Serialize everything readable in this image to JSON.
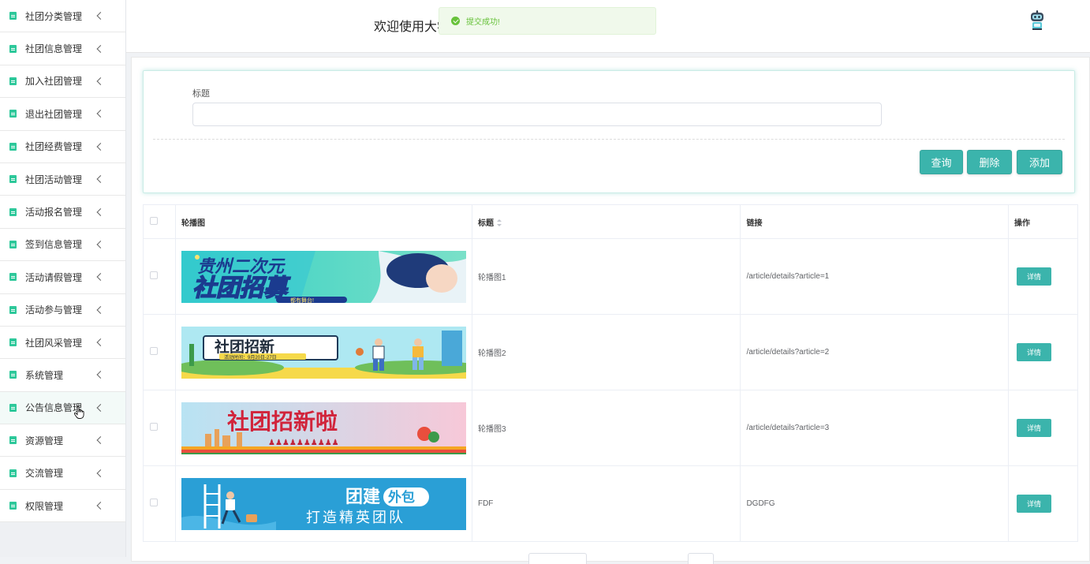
{
  "sidebar": {
    "items": [
      {
        "label": "社团分类管理"
      },
      {
        "label": "社团信息管理"
      },
      {
        "label": "加入社团管理"
      },
      {
        "label": "退出社团管理"
      },
      {
        "label": "社团经费管理"
      },
      {
        "label": "社团活动管理"
      },
      {
        "label": "活动报名管理"
      },
      {
        "label": "签到信息管理"
      },
      {
        "label": "活动请假管理"
      },
      {
        "label": "活动参与管理"
      },
      {
        "label": "社团风采管理"
      },
      {
        "label": "系统管理"
      },
      {
        "label": "公告信息管理"
      },
      {
        "label": "资源管理"
      },
      {
        "label": "交流管理"
      },
      {
        "label": "权限管理"
      }
    ],
    "active_index": 12,
    "accent_color": "#2dc89a"
  },
  "header": {
    "welcome": "欢迎使用大学",
    "avatar_icon": "robot-icon"
  },
  "toast": {
    "message": "提交成功!",
    "type": "success",
    "color": "#67c23a"
  },
  "search": {
    "title_label": "标题",
    "title_value": "",
    "query_label": "查询",
    "delete_label": "删除",
    "add_label": "添加",
    "button_color": "#3bb4ac"
  },
  "table": {
    "headers": {
      "image": "轮播图",
      "title": "标题",
      "link": "链接",
      "operation": "操作"
    },
    "rows": [
      {
        "title": "轮播图1",
        "link": "/article/details?article=1",
        "detail": "详情",
        "banner": {
          "line1": "贵州二次元",
          "line2": "社团招募",
          "line3": "都有舞台!"
        }
      },
      {
        "title": "轮播图2",
        "link": "/article/details?article=2",
        "detail": "详情",
        "banner": {
          "line1": "社团招新",
          "line2": "活动时间：9月20日-27日"
        }
      },
      {
        "title": "轮播图3",
        "link": "/article/details?article=3",
        "detail": "详情",
        "banner": {
          "line1": "社团招新啦"
        }
      },
      {
        "title": "FDF",
        "link": "DGDFG",
        "detail": "详情",
        "banner": {
          "line1": "团建",
          "line2": "外包",
          "line3": "打造精英团队"
        }
      }
    ]
  }
}
